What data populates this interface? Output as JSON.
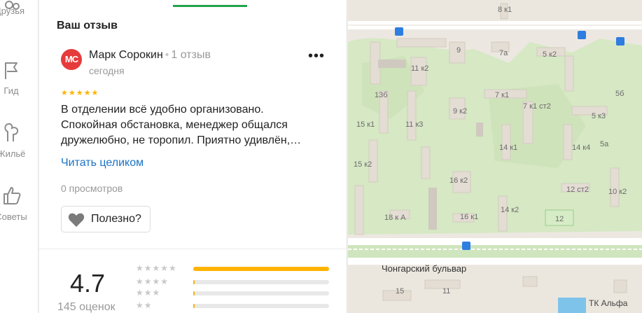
{
  "rail": {
    "items": [
      {
        "label": "Друзья",
        "icon": "friends-icon"
      },
      {
        "label": "Гид",
        "icon": "flag-icon"
      },
      {
        "label": "Жильё",
        "icon": "housing-icon"
      },
      {
        "label": "Советы",
        "icon": "thumbs-up-icon"
      }
    ]
  },
  "review": {
    "section_title": "Ваш отзыв",
    "author_initials": "МС",
    "author_name": "Марк Сорокин",
    "author_reviews": "1 отзыв",
    "date": "сегодня",
    "stars": "★★★★★",
    "rating_value": 5,
    "text_lines": [
      "В отделении всё удобно организовано.",
      "Спокойная обстановка, менеджер общался",
      "дружелюбно, не торопил. Приятно удивлён,…"
    ],
    "read_more": "Читать целиком",
    "views": "0 просмотров",
    "useful_label": "Полезно?"
  },
  "summary": {
    "rating": "4.7",
    "count": "145 оценок",
    "distribution": [
      {
        "stars": "★★★★★",
        "fraction": 1.0
      },
      {
        "stars": "★★★★",
        "fraction": 0.01
      },
      {
        "stars": "★★★",
        "fraction": 0.01
      },
      {
        "stars": "★★",
        "fraction": 0.01
      }
    ]
  },
  "map": {
    "street": "Чонгарский бульвар",
    "poi": "ТК Альфа",
    "buildings": [
      "8 к1",
      "9",
      "7а",
      "5 к2",
      "11 к2",
      "13б",
      "7 к1",
      "5б",
      "9 к2",
      "7 к1 ст2",
      "5 к3",
      "15 к1",
      "11 к3",
      "14 к1",
      "14 к4",
      "5а",
      "15 к2",
      "16 к2",
      "12 ст2",
      "10 к2",
      "18 к А",
      "16 к1",
      "14 к2",
      "12",
      "15",
      "11"
    ]
  },
  "colors": {
    "accent_green": "#22a34a",
    "star_yellow": "#ffb300",
    "link_blue": "#1a73c6",
    "avatar_red": "#e63b3b"
  }
}
